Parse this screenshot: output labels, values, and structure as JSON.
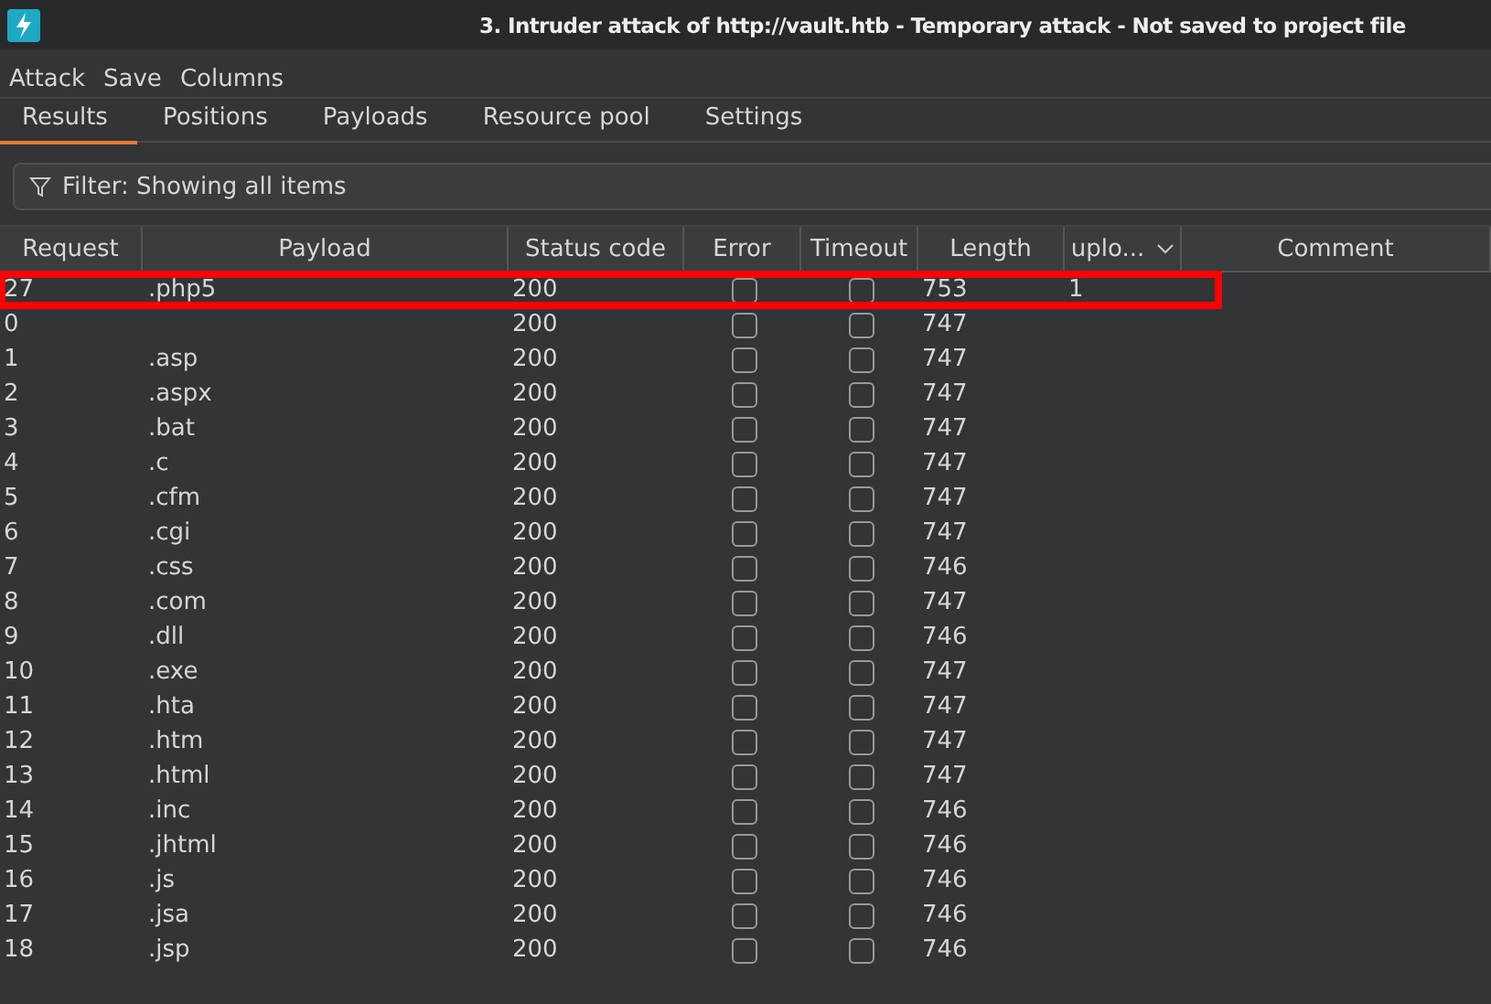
{
  "window": {
    "title": "3. Intruder attack of http://vault.htb - Temporary attack - Not saved to project file"
  },
  "menu": [
    "Attack",
    "Save",
    "Columns"
  ],
  "tabs": [
    {
      "label": "Results",
      "selected": true
    },
    {
      "label": "Positions",
      "selected": false
    },
    {
      "label": "Payloads",
      "selected": false
    },
    {
      "label": "Resource pool",
      "selected": false
    },
    {
      "label": "Settings",
      "selected": false
    }
  ],
  "filter": {
    "text": "Filter: Showing all items"
  },
  "table": {
    "columns": [
      "Request",
      "Payload",
      "Status code",
      "Error",
      "Timeout",
      "Length",
      "uplo...",
      "Comment"
    ],
    "rows": [
      {
        "request": "27",
        "payload": ".php5",
        "status": "200",
        "error": false,
        "timeout": false,
        "length": "753",
        "upload": "1",
        "highlighted": true
      },
      {
        "request": "0",
        "status": "200",
        "error": false,
        "timeout": false,
        "length": "747",
        "highlighted": false
      },
      {
        "request": "1",
        "payload": ".asp",
        "status": "200",
        "error": false,
        "timeout": false,
        "length": "747",
        "highlighted": false
      },
      {
        "request": "2",
        "payload": ".aspx",
        "status": "200",
        "error": false,
        "timeout": false,
        "length": "747",
        "highlighted": false
      },
      {
        "request": "3",
        "payload": ".bat",
        "status": "200",
        "error": false,
        "timeout": false,
        "length": "747",
        "highlighted": false
      },
      {
        "request": "4",
        "payload": ".c",
        "status": "200",
        "error": false,
        "timeout": false,
        "length": "747",
        "highlighted": false
      },
      {
        "request": "5",
        "payload": ".cfm",
        "status": "200",
        "error": false,
        "timeout": false,
        "length": "747",
        "highlighted": false
      },
      {
        "request": "6",
        "payload": ".cgi",
        "status": "200",
        "error": false,
        "timeout": false,
        "length": "747",
        "highlighted": false
      },
      {
        "request": "7",
        "payload": ".css",
        "status": "200",
        "error": false,
        "timeout": false,
        "length": "746",
        "highlighted": false
      },
      {
        "request": "8",
        "payload": ".com",
        "status": "200",
        "error": false,
        "timeout": false,
        "length": "747",
        "highlighted": false
      },
      {
        "request": "9",
        "payload": ".dll",
        "status": "200",
        "error": false,
        "timeout": false,
        "length": "746",
        "highlighted": false
      },
      {
        "request": "10",
        "payload": ".exe",
        "status": "200",
        "error": false,
        "timeout": false,
        "length": "747",
        "highlighted": false
      },
      {
        "request": "11",
        "payload": ".hta",
        "status": "200",
        "error": false,
        "timeout": false,
        "length": "747",
        "highlighted": false
      },
      {
        "request": "12",
        "payload": ".htm",
        "status": "200",
        "error": false,
        "timeout": false,
        "length": "747",
        "highlighted": false
      },
      {
        "request": "13",
        "payload": ".html",
        "status": "200",
        "error": false,
        "timeout": false,
        "length": "747",
        "highlighted": false
      },
      {
        "request": "14",
        "payload": ".inc",
        "status": "200",
        "error": false,
        "timeout": false,
        "length": "746",
        "highlighted": false
      },
      {
        "request": "15",
        "payload": ".jhtml",
        "status": "200",
        "error": false,
        "timeout": false,
        "length": "746",
        "highlighted": false
      },
      {
        "request": "16",
        "payload": ".js",
        "status": "200",
        "error": false,
        "timeout": false,
        "length": "746",
        "highlighted": false
      },
      {
        "request": "17",
        "payload": ".jsa",
        "status": "200",
        "error": false,
        "timeout": false,
        "length": "746",
        "highlighted": false
      },
      {
        "request": "18",
        "payload": ".jsp",
        "status": "200",
        "error": false,
        "timeout": false,
        "length": "746",
        "highlighted": false
      }
    ]
  }
}
